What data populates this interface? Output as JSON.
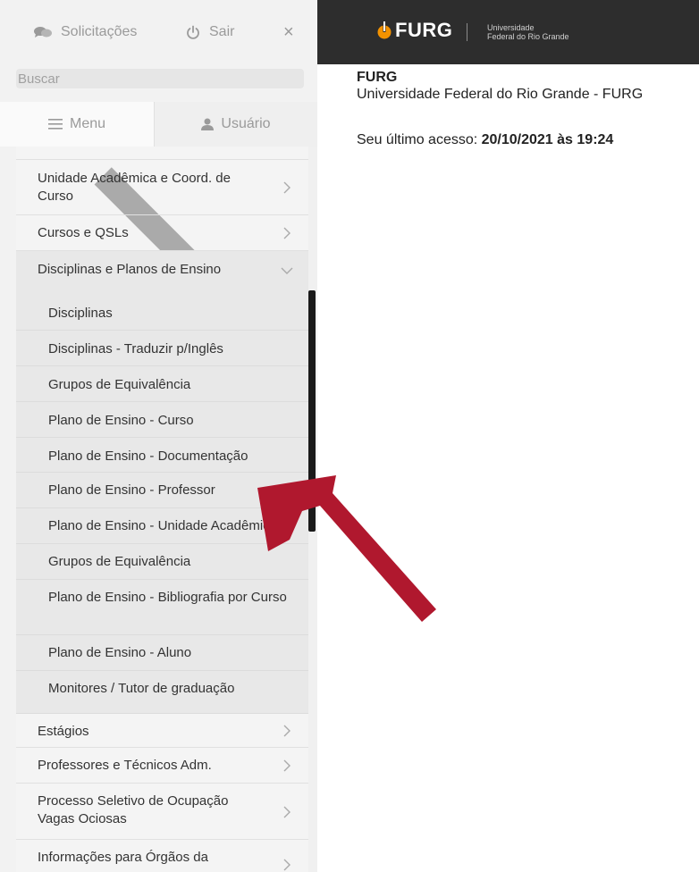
{
  "topbar": {
    "requests_label": "Solicitações",
    "logout_label": "Sair",
    "close_label": "×"
  },
  "search": {
    "placeholder": "Buscar"
  },
  "tabs": {
    "menu_label": "Menu",
    "user_label": "Usuário"
  },
  "menu": {
    "items_top": [
      {
        "label": "Unidade Acadêmica e Coord. de Curso"
      },
      {
        "label": "Cursos e QSLs"
      },
      {
        "label": "Disciplinas e Planos de Ensino"
      }
    ],
    "submenu": [
      {
        "label": "Disciplinas"
      },
      {
        "label": "Disciplinas - Traduzir p/Inglês"
      },
      {
        "label": "Grupos de Equivalência"
      },
      {
        "label": "Plano de Ensino - Curso"
      },
      {
        "label": "Plano de Ensino - Documentação"
      },
      {
        "label": "Plano de Ensino - Professor"
      },
      {
        "label": "Plano de Ensino - Unidade Acadêmica"
      },
      {
        "label": "Grupos de Equivalência"
      },
      {
        "label": "Plano de Ensino - Bibliografia por Curso"
      },
      {
        "label": "Plano de Ensino - Aluno"
      },
      {
        "label": "Monitores / Tutor de graduação"
      }
    ],
    "items_bottom": [
      {
        "label": "Estágios"
      },
      {
        "label": "Professores e Técnicos Adm."
      },
      {
        "label": "Processo Seletivo de Ocupação Vagas Ociosas"
      },
      {
        "label": "Informações para Órgãos da"
      }
    ]
  },
  "header": {
    "logo_text": "FURG",
    "logo_sub_line1": "Universidade",
    "logo_sub_line2": "Federal do Rio Grande"
  },
  "main": {
    "org_short": "FURG",
    "org_full": "Universidade Federal do Rio Grande - FURG",
    "last_access_label": "Seu último acesso: ",
    "last_access_value": "20/10/2021 às 19:24"
  },
  "colors": {
    "header_bg": "#2d2d2d",
    "logo_accent": "#f39200",
    "annotation_arrow": "#b0182e",
    "sidebar_bg": "#f2f2f2"
  }
}
